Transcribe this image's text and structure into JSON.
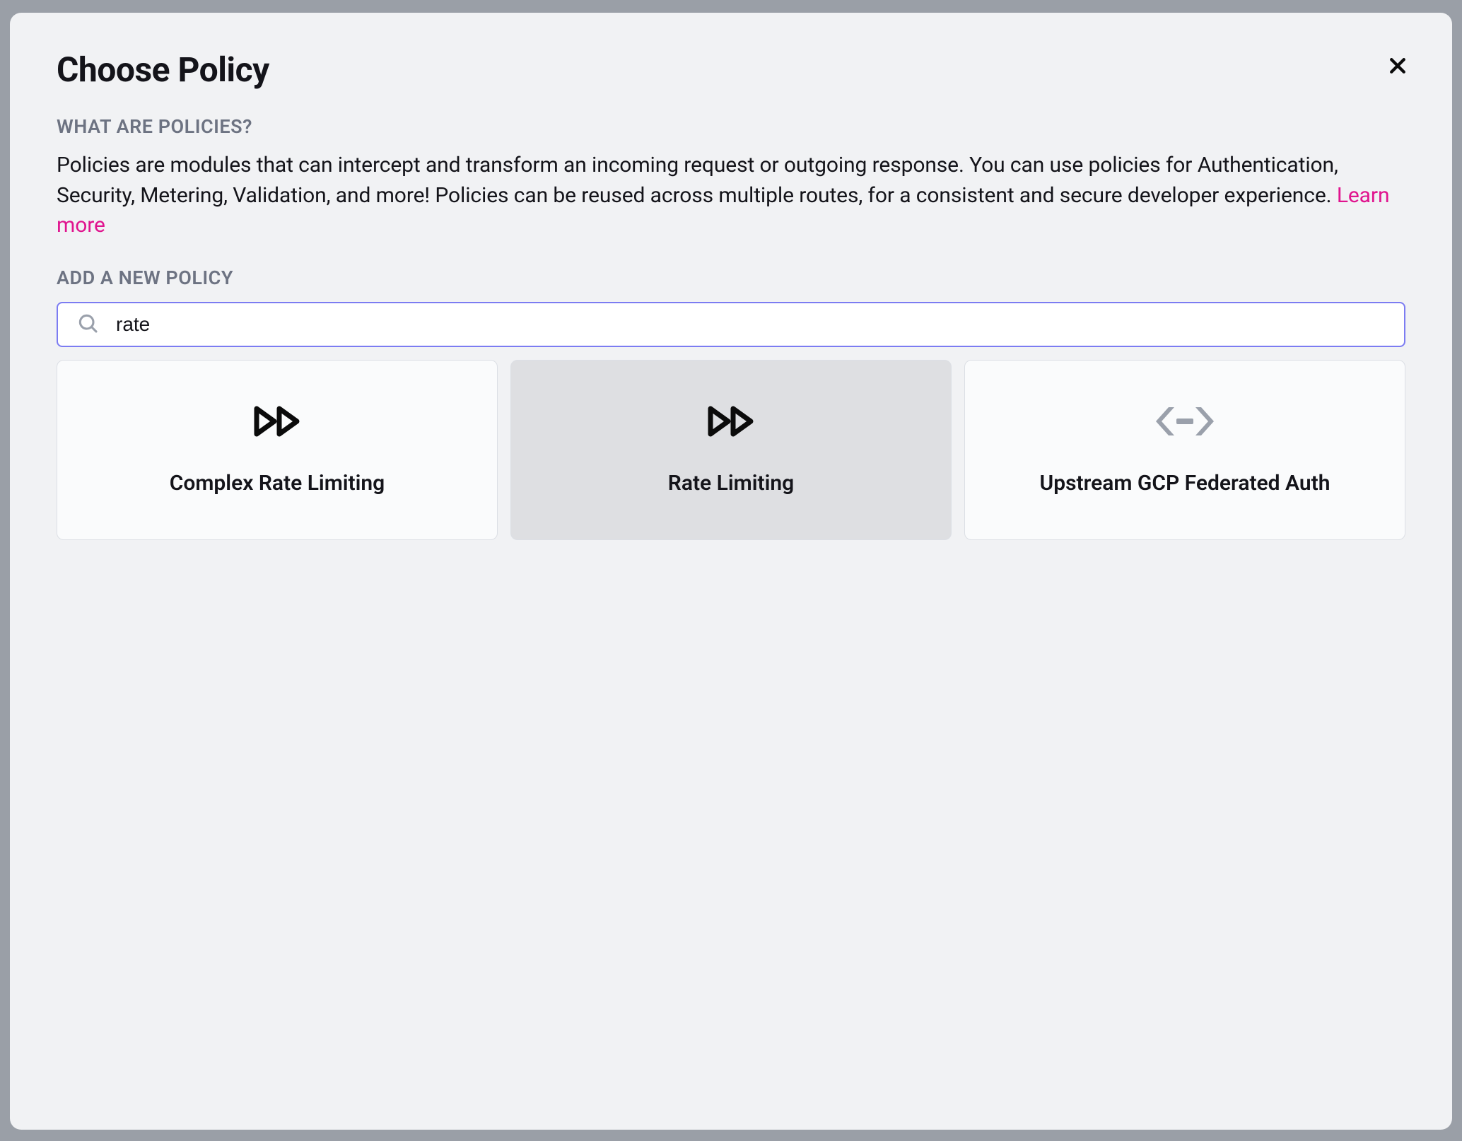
{
  "modal": {
    "title": "Choose Policy",
    "what_label": "WHAT ARE POLICIES?",
    "description_part1": "Policies are modules that can intercept and transform an incoming request or outgoing response. You can use policies for Authentication, Security, Metering, Validation, and more! Policies can be reused across multiple routes, for a consistent and secure developer experience. ",
    "learn_more": "Learn more",
    "add_label": "ADD A NEW POLICY",
    "search": {
      "value": "rate",
      "placeholder": ""
    },
    "cards": [
      {
        "label": "Complex Rate Limiting",
        "icon": "fast-forward",
        "selected": false
      },
      {
        "label": "Rate Limiting",
        "icon": "fast-forward",
        "selected": true
      },
      {
        "label": "Upstream GCP Federated Auth",
        "icon": "brackets",
        "selected": false
      }
    ]
  }
}
